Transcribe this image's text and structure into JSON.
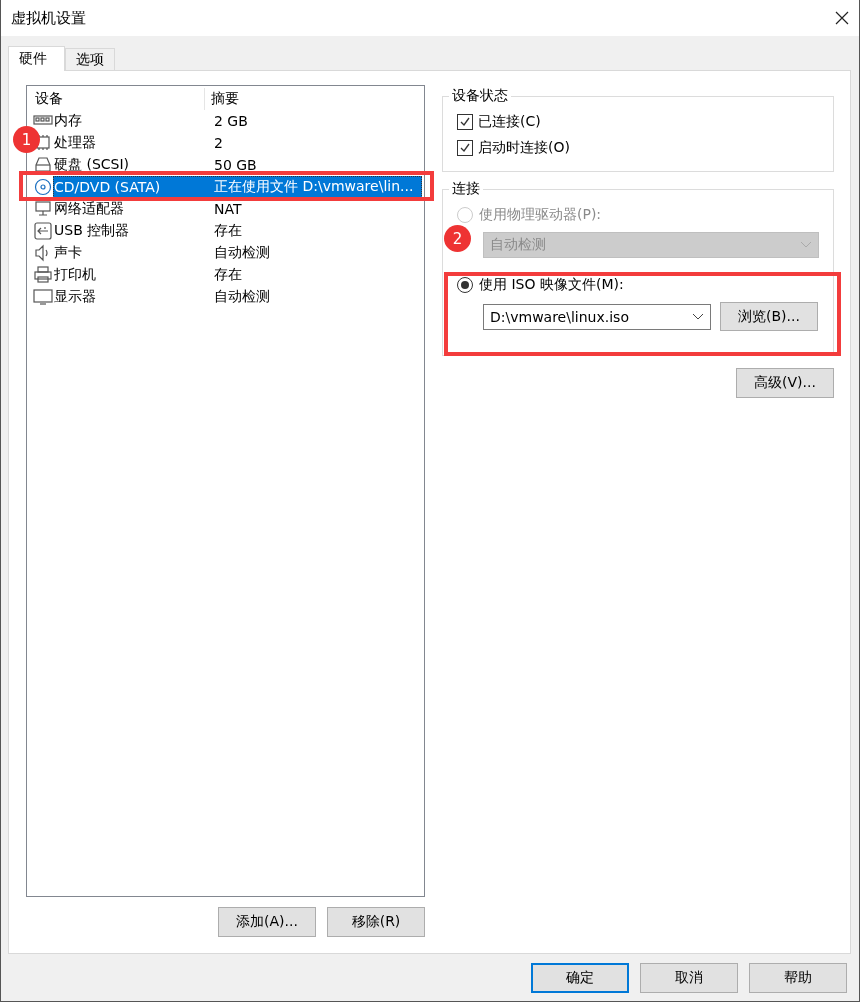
{
  "window": {
    "title": "虚拟机设置"
  },
  "tabs": [
    {
      "label": "硬件",
      "selected": true
    },
    {
      "label": "选项",
      "selected": false
    }
  ],
  "device_list": {
    "columns": [
      "设备",
      "摘要"
    ],
    "rows": [
      {
        "device": "内存",
        "summary": "2 GB",
        "selected": false
      },
      {
        "device": "处理器",
        "summary": "2",
        "selected": false
      },
      {
        "device": "硬盘 (SCSI)",
        "summary": "50 GB",
        "selected": false
      },
      {
        "device": "CD/DVD (SATA)",
        "summary": "正在使用文件 D:\\vmware\\lin...",
        "selected": true
      },
      {
        "device": "网络适配器",
        "summary": "NAT",
        "selected": false
      },
      {
        "device": "USB 控制器",
        "summary": "存在",
        "selected": false
      },
      {
        "device": "声卡",
        "summary": "自动检测",
        "selected": false
      },
      {
        "device": "打印机",
        "summary": "存在",
        "selected": false
      },
      {
        "device": "显示器",
        "summary": "自动检测",
        "selected": false
      }
    ]
  },
  "list_buttons": [
    "添加(A)...",
    "移除(R)"
  ],
  "device_status": {
    "title": "设备状态",
    "options": [
      {
        "label": "已连接(C)",
        "checked": true
      },
      {
        "label": "启动时连接(O)",
        "checked": true
      }
    ]
  },
  "connection": {
    "title": "连接",
    "physical": {
      "label": "使用物理驱动器(P):",
      "selected": false,
      "disabled": true,
      "dropdown": "自动检测"
    },
    "iso": {
      "label": "使用 ISO 映像文件(M):",
      "selected": true,
      "disabled": false,
      "value": "D:\\vmware\\linux.iso",
      "browse": "浏览(B)..."
    }
  },
  "advanced_button": "高级(V)...",
  "dialog_buttons": [
    {
      "label": "确定",
      "default": true
    },
    {
      "label": "取消",
      "default": false
    },
    {
      "label": "帮助",
      "default": false
    }
  ],
  "annotations": [
    {
      "label": "1"
    },
    {
      "label": "2"
    }
  ]
}
